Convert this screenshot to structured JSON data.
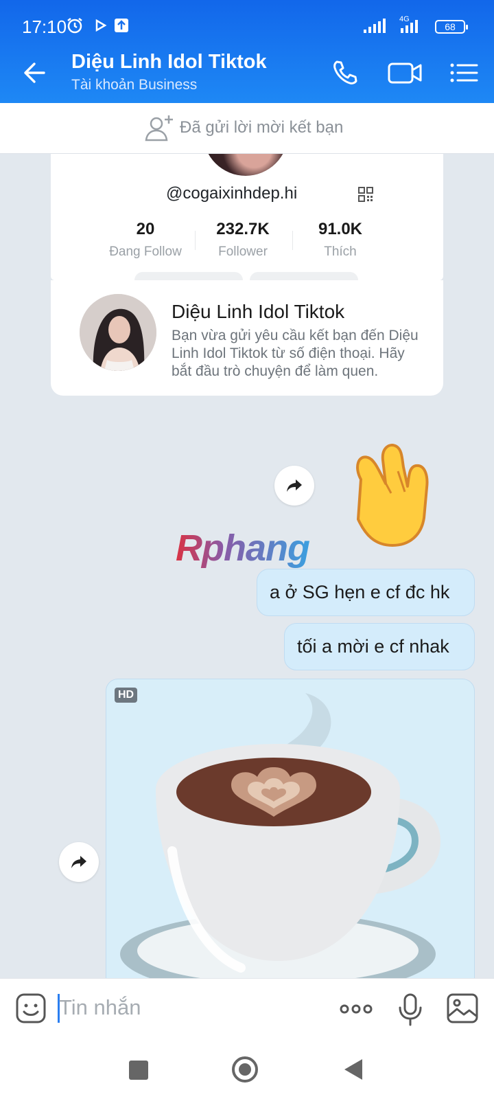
{
  "status_bar": {
    "time": "17:10",
    "network": "4G",
    "battery": "68"
  },
  "header": {
    "title": "Diệu Linh Idol Tiktok",
    "subtitle": "Tài khoản Business"
  },
  "banner": {
    "text": "Đã gửi lời mời kết bạn"
  },
  "profile": {
    "handle": "@cogaixinhdep.hi",
    "stats": [
      {
        "value": "20",
        "label": "Đang Follow"
      },
      {
        "value": "232.7K",
        "label": "Follower"
      },
      {
        "value": "91.0K",
        "label": "Thích"
      }
    ]
  },
  "contact_card": {
    "name": "Diệu Linh Idol Tiktok",
    "description": "Bạn vừa gửi yêu cầu kết bạn đến Diệu Linh Idol Tiktok từ số điện thoại. Hãy bắt đầu trò chuyện để làm quen."
  },
  "watermark": "Rphang",
  "messages": [
    {
      "text": "a ở SG hẹn e cf đc hk"
    },
    {
      "text": "tối a mời e cf nhak"
    }
  ],
  "image_message": {
    "badge": "HD"
  },
  "composer": {
    "placeholder": "Tin nhắn"
  }
}
